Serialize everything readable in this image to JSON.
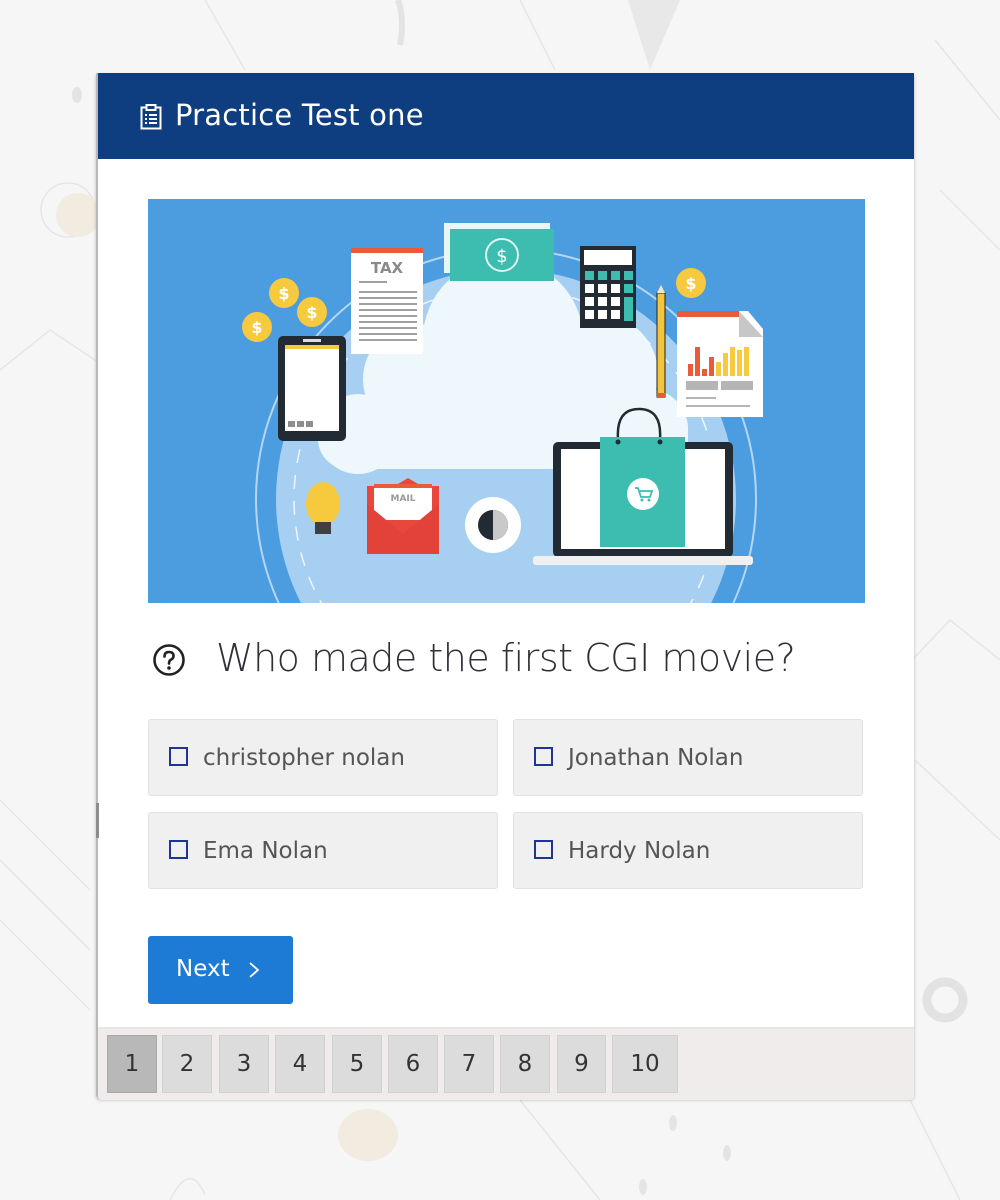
{
  "quiz": {
    "title": "Practice Test one",
    "header_icon": "clipboard-list-icon",
    "header_color": "#0e3e7f",
    "hero_image": {
      "alt": "Illustration of a cloud surrounded by finance and e-commerce icons",
      "labels": {
        "tax_doc": "TAX",
        "mail": "MAIL",
        "coin": "$"
      }
    },
    "question": {
      "icon": "question-circle-icon",
      "text": "Who made the first CGI movie?"
    },
    "options": [
      {
        "label": "christopher nolan",
        "checked": false
      },
      {
        "label": "Jonathan Nolan",
        "checked": false
      },
      {
        "label": "Ema Nolan",
        "checked": false
      },
      {
        "label": "Hardy Nolan",
        "checked": false
      }
    ],
    "next_button": {
      "label": "Next",
      "icon": "chevron-right-icon",
      "color": "#1d7ad5"
    },
    "pagination": {
      "current": "1",
      "pages": [
        "1",
        "2",
        "3",
        "4",
        "5",
        "6",
        "7",
        "8",
        "9",
        "10"
      ]
    }
  }
}
